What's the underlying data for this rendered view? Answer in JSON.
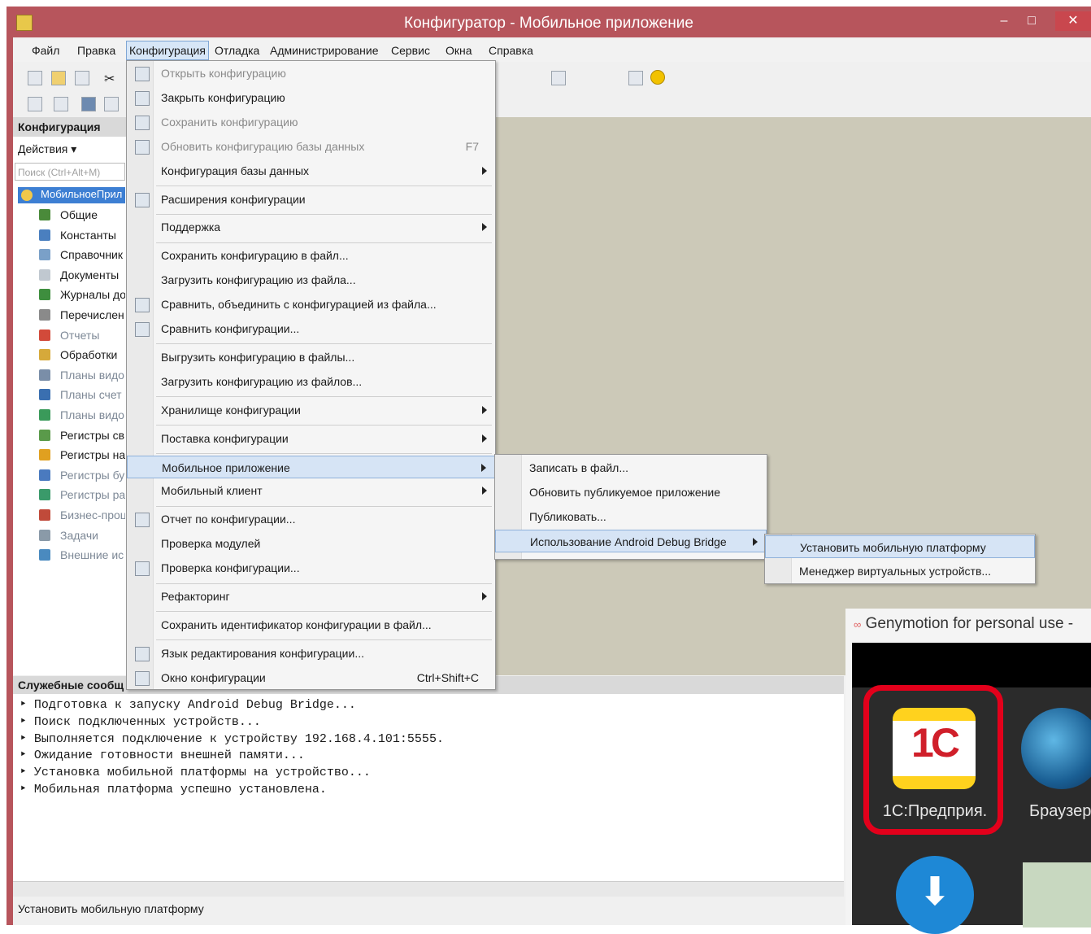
{
  "window": {
    "title": "Конфигуратор - Мобильное приложение",
    "controls": {
      "minimize": "–",
      "maximize": "□",
      "close": "✕"
    }
  },
  "menubar": [
    "Файл",
    "Правка",
    "Конфигурация",
    "Отладка",
    "Администрирование",
    "Сервис",
    "Окна",
    "Справка"
  ],
  "panel": {
    "header": "Конфигурация",
    "actions": "Действия ▾",
    "search_placeholder": "Поиск (Ctrl+Alt+M)",
    "root": "МобильноеПрил",
    "tree": [
      {
        "label": "Общие",
        "dim": false,
        "icon": "general-icon",
        "color": "#4a8a3a"
      },
      {
        "label": "Константы",
        "dim": false,
        "icon": "constants-icon",
        "color": "#4a7fbf"
      },
      {
        "label": "Справочник",
        "dim": false,
        "icon": "catalogs-icon",
        "color": "#7aa0c8"
      },
      {
        "label": "Документы",
        "dim": false,
        "icon": "documents-icon",
        "color": "#c0c8d0"
      },
      {
        "label": "Журналы до",
        "dim": false,
        "icon": "journals-icon",
        "color": "#3e8e3e"
      },
      {
        "label": "Перечислен",
        "dim": false,
        "icon": "enums-icon",
        "color": "#8a8a8a"
      },
      {
        "label": "Отчеты",
        "dim": true,
        "icon": "reports-icon",
        "color": "#d24a3a"
      },
      {
        "label": "Обработки",
        "dim": false,
        "icon": "dataprocessors-icon",
        "color": "#d6a93a"
      },
      {
        "label": "Планы видо",
        "dim": true,
        "icon": "plans-icon",
        "color": "#7a8ea8"
      },
      {
        "label": "Планы счет",
        "dim": true,
        "icon": "accounts-icon",
        "color": "#3a6fb0"
      },
      {
        "label": "Планы видо",
        "dim": true,
        "icon": "plans2-icon",
        "color": "#3a9a5a"
      },
      {
        "label": "Регистры св",
        "dim": false,
        "icon": "registers-icon",
        "color": "#5a9a4a"
      },
      {
        "label": "Регистры на",
        "dim": false,
        "icon": "accum-registers-icon",
        "color": "#e0a020"
      },
      {
        "label": "Регистры бу",
        "dim": true,
        "icon": "acc-registers-icon",
        "color": "#4a7abf"
      },
      {
        "label": "Регистры ра",
        "dim": true,
        "icon": "calc-registers-icon",
        "color": "#3a9a6a"
      },
      {
        "label": "Бизнес-проц",
        "dim": true,
        "icon": "business-icon",
        "color": "#c04a3a"
      },
      {
        "label": "Задачи",
        "dim": true,
        "icon": "tasks-icon",
        "color": "#8a9aa8"
      },
      {
        "label": "Внешние ис",
        "dim": true,
        "icon": "external-icon",
        "color": "#4a8abf"
      }
    ]
  },
  "config_menu": [
    {
      "label": "Открыть конфигурацию",
      "disabled": true,
      "icon": true
    },
    {
      "label": "Закрыть конфигурацию",
      "disabled": false,
      "icon": true
    },
    {
      "label": "Сохранить конфигурацию",
      "disabled": true,
      "icon": true
    },
    {
      "label": "Обновить конфигурацию базы данных",
      "disabled": true,
      "shortcut": "F7",
      "icon": true
    },
    {
      "label": "Конфигурация базы данных",
      "submenu": true
    },
    {
      "sep": true
    },
    {
      "label": "Расширения конфигурации",
      "icon": true
    },
    {
      "sep": true
    },
    {
      "label": "Поддержка",
      "submenu": true
    },
    {
      "sep": true
    },
    {
      "label": "Сохранить конфигурацию в файл..."
    },
    {
      "label": "Загрузить конфигурацию из файла..."
    },
    {
      "label": "Сравнить, объединить с конфигурацией из файла...",
      "icon": true
    },
    {
      "label": "Сравнить конфигурации...",
      "icon": true
    },
    {
      "sep": true
    },
    {
      "label": "Выгрузить конфигурацию в файлы..."
    },
    {
      "label": "Загрузить конфигурацию из файлов..."
    },
    {
      "sep": true
    },
    {
      "label": "Хранилище конфигурации",
      "submenu": true
    },
    {
      "sep": true
    },
    {
      "label": "Поставка конфигурации",
      "submenu": true
    },
    {
      "sep": true
    },
    {
      "label": "Мобильное приложение",
      "submenu": true,
      "highlight": true
    },
    {
      "label": "Мобильный клиент",
      "submenu": true
    },
    {
      "sep": true
    },
    {
      "label": "Отчет по конфигурации...",
      "icon": true
    },
    {
      "label": "Проверка модулей"
    },
    {
      "label": "Проверка конфигурации...",
      "icon": true
    },
    {
      "sep": true
    },
    {
      "label": "Рефакторинг",
      "submenu": true
    },
    {
      "sep": true
    },
    {
      "label": "Сохранить идентификатор конфигурации в файл..."
    },
    {
      "sep": true
    },
    {
      "label": "Язык редактирования конфигурации...",
      "icon": true
    },
    {
      "label": "Окно конфигурации",
      "shortcut": "Ctrl+Shift+C",
      "icon": true
    }
  ],
  "mobile_menu": [
    {
      "label": "Записать в файл..."
    },
    {
      "label": "Обновить публикуемое приложение"
    },
    {
      "label": "Публиковать..."
    },
    {
      "label": "Использование Android Debug Bridge",
      "submenu": true,
      "highlight": true
    }
  ],
  "adb_menu": [
    {
      "label": "Установить мобильную платформу",
      "highlight": true
    },
    {
      "label": "Менеджер виртуальных устройств..."
    }
  ],
  "messages": {
    "header": "Служебные сообщ",
    "lines": [
      "Подготовка к запуску Android Debug Bridge...",
      "Поиск подключенных устройств...",
      "Выполняется подключение к устройству 192.168.4.101:5555.",
      "Ожидание готовности внешней памяти...",
      "Установка мобильной платформы на устройство...",
      "Мобильная платформа успешно установлена."
    ]
  },
  "status": "Установить мобильную платформу",
  "genymotion": {
    "title": "Genymotion for personal use -",
    "app1_label": "1С:Предприя.",
    "app1_logo": "1С",
    "app2_label": "Браузер",
    "highlight_color": "#e3001b"
  }
}
